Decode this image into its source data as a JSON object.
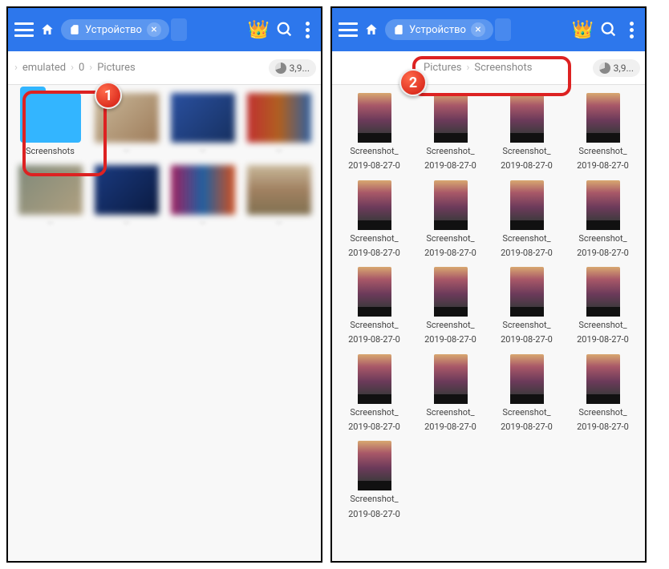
{
  "colors": {
    "toolbar": "#2d77ec",
    "folder": "#33b5ff",
    "annot": "#d22"
  },
  "left": {
    "tab_label": "Устройство",
    "breadcrumb": [
      "emulated",
      "0",
      "Pictures"
    ],
    "storage": "3,9...",
    "folder_label": "Screenshots",
    "blurred_placeholders": 7,
    "badge": "1"
  },
  "right": {
    "tab_label": "Устройство",
    "breadcrumb": [
      "Pictures",
      "Screenshots"
    ],
    "storage": "3,9...",
    "badge": "2",
    "items": [
      {
        "name": "Screenshot_",
        "date": "2019-08-27-0"
      },
      {
        "name": "Screenshot_",
        "date": "2019-08-27-0"
      },
      {
        "name": "Screenshot_",
        "date": "2019-08-27-0"
      },
      {
        "name": "Screenshot_",
        "date": "2019-08-27-0"
      },
      {
        "name": "Screenshot_",
        "date": "2019-08-27-0"
      },
      {
        "name": "Screenshot_",
        "date": "2019-08-27-0"
      },
      {
        "name": "Screenshot_",
        "date": "2019-08-27-0"
      },
      {
        "name": "Screenshot_",
        "date": "2019-08-27-0"
      },
      {
        "name": "Screenshot_",
        "date": "2019-08-27-0"
      },
      {
        "name": "Screenshot_",
        "date": "2019-08-27-0"
      },
      {
        "name": "Screenshot_",
        "date": "2019-08-27-0"
      },
      {
        "name": "Screenshot_",
        "date": "2019-08-27-0"
      },
      {
        "name": "Screenshot_",
        "date": "2019-08-27-0"
      },
      {
        "name": "Screenshot_",
        "date": "2019-08-27-0"
      },
      {
        "name": "Screenshot_",
        "date": "2019-08-27-0"
      },
      {
        "name": "Screenshot_",
        "date": "2019-08-27-0"
      },
      {
        "name": "Screenshot_",
        "date": "2019-08-27-0"
      }
    ]
  }
}
